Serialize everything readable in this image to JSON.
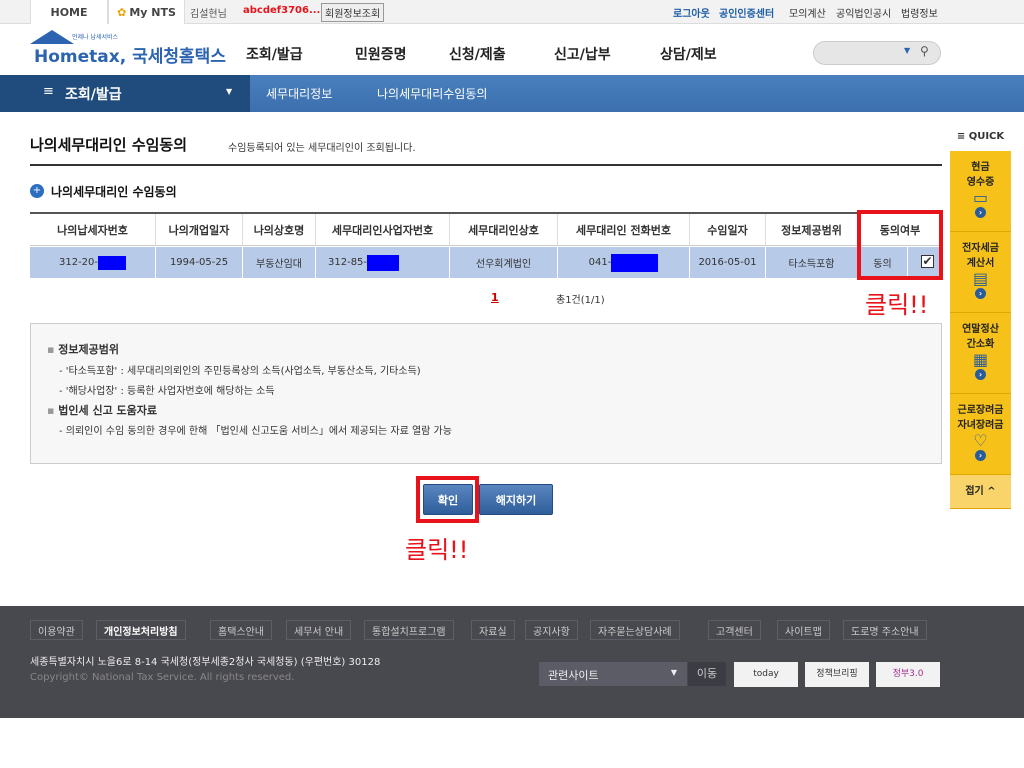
{
  "topbar": {
    "home": "HOME",
    "mynts": "My NTS",
    "user": "김설현님",
    "userid": "abcdef3706...",
    "member_info": "회원정보조회",
    "links": [
      "로그아웃",
      "공인인증센터",
      "모의계산",
      "공익법인공시",
      "법령정보"
    ]
  },
  "header": {
    "logo": "Hometax, 국세청홈택스",
    "logo_sub": "언제나 납세서비스",
    "nav": [
      "조회/발급",
      "민원증명",
      "신청/제출",
      "신고/납부",
      "상담/제보"
    ]
  },
  "breadcrumb": {
    "menu": "조회/발급",
    "items": [
      "세무대리정보",
      "나의세무대리수임동의"
    ]
  },
  "page": {
    "title": "나의세무대리인 수임동의",
    "desc": "수임등록되어 있는 세무대리인이 조회됩니다.",
    "section": "나의세무대리인 수임동의"
  },
  "table": {
    "headers": [
      "나의납세자번호",
      "나의개업일자",
      "나의상호명",
      "세무대리인사업자번호",
      "세무대리인상호",
      "세무대리인 전화번호",
      "수임일자",
      "정보제공범위",
      "동의여부"
    ],
    "rows": [
      {
        "taxpayer_no": "312-20-",
        "open_date": "1994-05-25",
        "company": "부동산임대",
        "agent_no": "312-85-",
        "agent_name": "선우회계법인",
        "agent_phone": "041-",
        "date": "2016-05-01",
        "scope": "타소득포함",
        "consent": "동의",
        "checked": true
      }
    ]
  },
  "pagination": {
    "page": "1",
    "total": "총1건(1/1)"
  },
  "info": {
    "h1": "정보제공범위",
    "l1": "- '타소득포함' : 세무대리의뢰인의 주민등록상의 소득(사업소득, 부동산소득, 기타소득)",
    "l2": "- '해당사업장' : 등록한 사업자번호에 해당하는 소득",
    "h2": "법인세 신고 도움자료",
    "l3": "- 의뢰인이 수임 동의한 경우에 한해 「법인세 신고도움 서비스」에서 제공되는 자료 열람 가능"
  },
  "buttons": {
    "confirm": "확인",
    "cancel": "해지하기"
  },
  "annotations": {
    "click1": "클릭!!",
    "click2": "클릭!!"
  },
  "quick": {
    "title": "QUICK",
    "items": [
      "현금 영수증",
      "전자세금 계산서",
      "연말정산 간소화",
      "근로장려금 자녀장려금"
    ],
    "fold": "접기"
  },
  "footer": {
    "links": [
      "이용약관",
      "개인정보처리방침",
      "홈택스안내",
      "세무서 안내",
      "통합설치프로그램",
      "자료실",
      "공지사항",
      "자주묻는상담사례",
      "고객센터",
      "사이트맵",
      "도로명 주소안내"
    ],
    "address": "세종특별자치시 노을6로 8-14 국세청(정부세종2청사 국세청동) (우편번호) 30128",
    "copyright": "Copyright© National Tax Service. All rights reserved.",
    "related": "관련사이트",
    "go": "이동",
    "banners": [
      "today",
      "정책브리핑",
      "정부3.0"
    ]
  }
}
